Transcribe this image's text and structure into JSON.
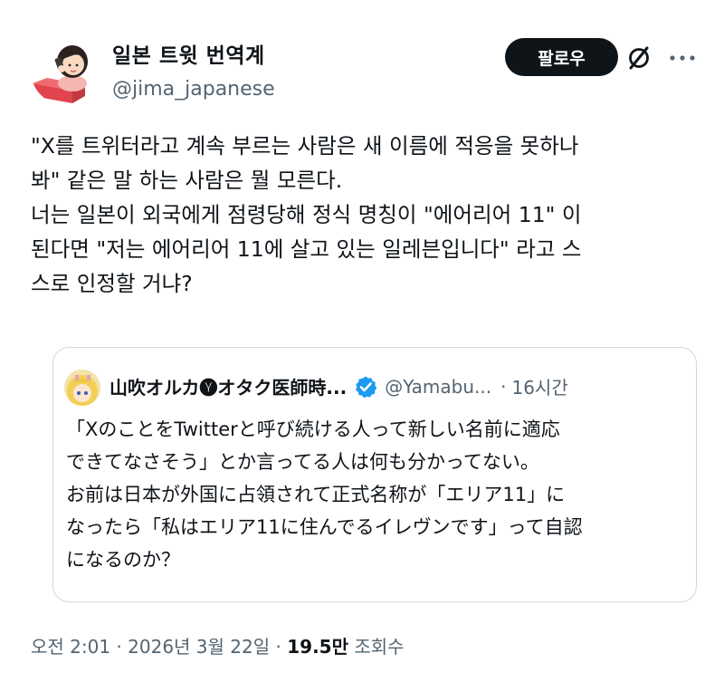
{
  "author": {
    "display_name": "일본 트윗 번역계",
    "handle": "@jima_japanese",
    "avatar": "woman-on-phone-avatar"
  },
  "actions": {
    "follow_label": "팔로우",
    "grok_icon": "grok-icon",
    "more_icon": "more-horizontal-icon"
  },
  "tweet": {
    "lines": [
      "\"X를 트위터라고 계속 부르는 사람은 새 이름에 적응을 못하나",
      "봐\" 같은 말 하는 사람은 뭘 모른다.",
      "너는 일본이 외국에게 점령당해 정식 명칭이 \"에어리어 11\" 이",
      "된다면 \"저는 에어리어 11에 살고 있는 일레븐입니다\" 라고 스",
      "스로 인정할 거냐?"
    ]
  },
  "quote": {
    "display_name": "山吹オルカ🅨オタク医師時...",
    "verified_icon": "verified-badge-icon",
    "handle": "@Yamabu...",
    "separator": "·",
    "time": "16시간",
    "lines": [
      "「XのことをTwitterと呼び続ける人って新しい名前に適応",
      "できてなさそう」とか言ってる人は何も分かってない。",
      "お前は日本が外国に占領されて正式名称が「エリア11」に",
      "なったら「私はエリア11に住んでるイレヴンです」って自認",
      "になるのか？"
    ]
  },
  "meta": {
    "time": "오전 2:01",
    "dot1": " · ",
    "date": "2026년 3월 22일",
    "dot2": " · ",
    "views": "19.5만",
    "views_label": " 조회수"
  },
  "colors": {
    "text": "#0f1419",
    "secondary": "#536471",
    "border": "#cfd9de",
    "verified": "#1d9bf0",
    "button_bg": "#0f1419"
  }
}
